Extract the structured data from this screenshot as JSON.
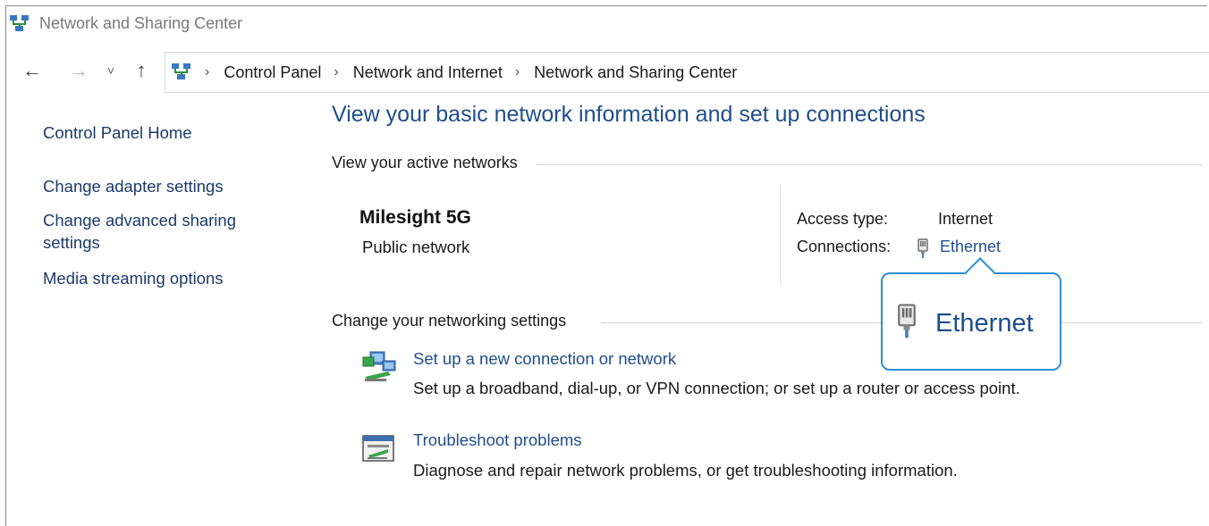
{
  "window": {
    "title": "Network and Sharing Center"
  },
  "navigation": {
    "back_icon": "arrow-left-icon",
    "forward_icon": "arrow-right-icon",
    "recent_icon": "chevron-down-icon",
    "up_icon": "arrow-up-icon",
    "back_glyph": "←",
    "forward_glyph": "→",
    "recent_glyph": "˅",
    "up_glyph": "↑",
    "separator": "›",
    "breadcrumbs": [
      "Control Panel",
      "Network and Internet",
      "Network and Sharing Center"
    ]
  },
  "sidebar": {
    "items": [
      {
        "label": "Control Panel Home"
      },
      {
        "label": "Change adapter settings"
      },
      {
        "label": "Change advanced sharing settings"
      },
      {
        "label": "Media streaming options"
      }
    ]
  },
  "main": {
    "heading": "View your basic network information and set up connections",
    "active_networks": {
      "section_label": "View your active networks",
      "network_name": "Milesight 5G",
      "network_type": "Public network",
      "access_type_label": "Access type:",
      "access_type_value": "Internet",
      "connections_label": "Connections:",
      "connection_name": "Ethernet",
      "connection_icon": "ethernet-cable-icon"
    },
    "change_settings": {
      "section_label": "Change your networking settings",
      "tasks": [
        {
          "icon": "new-connection-icon",
          "link": "Set up a new connection or network",
          "description": "Set up a broadband, dial-up, or VPN connection; or set up a router or access point."
        },
        {
          "icon": "troubleshoot-icon",
          "link": "Troubleshoot problems",
          "description": "Diagnose and repair network problems, or get troubleshooting information."
        }
      ]
    }
  },
  "callout": {
    "label": "Ethernet",
    "icon": "ethernet-cable-icon",
    "border_color": "#2a8fd6"
  },
  "colors": {
    "link": "#1e4e8c",
    "sidebar_link": "#1b3a6b",
    "heading": "#1e4e8c"
  }
}
